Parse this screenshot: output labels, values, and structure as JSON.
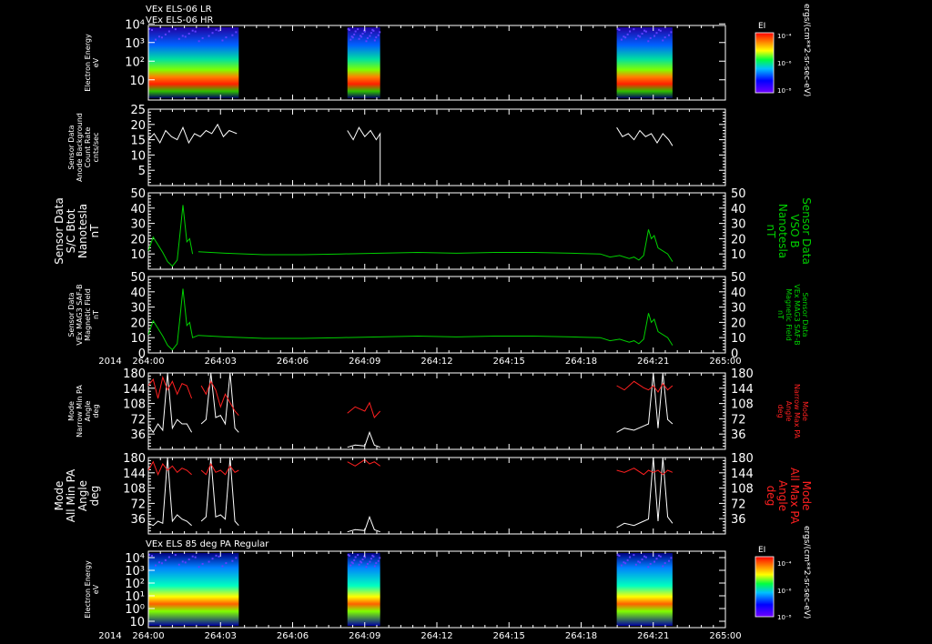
{
  "header": {
    "line1": "VEx ELS-06 LR",
    "line2": "VEx ELS-06 HR",
    "lower_title": "VEx ELS 85 deg PA Regular"
  },
  "colors": {
    "white": "#ffffff",
    "green": "#00d000",
    "red": "#ff2020",
    "frame": "#ffffff"
  },
  "time_axis": {
    "year": "2014",
    "ticks": [
      "264:00",
      "264:03",
      "264:06",
      "264:09",
      "264:12",
      "264:15",
      "264:18",
      "264:21",
      "265:00"
    ],
    "start_min": 0,
    "end_min": 60
  },
  "colorbar": {
    "label": "EI",
    "unit": "ergs/(cm**2-sr-sec-eV)",
    "top_ticks": [
      "10⁻⁴",
      "10⁻⁶",
      "10⁻⁸"
    ]
  },
  "chart_data": [
    {
      "id": "spectrogram_upper",
      "type": "heatmap",
      "ylabel": "Electron Energy",
      "yunit": "eV",
      "yticks": [
        "10",
        "10²",
        "10³",
        "10⁴"
      ],
      "data_intervals_min": [
        [
          0,
          9.4
        ],
        [
          20.7,
          24.1
        ],
        [
          48.7,
          54.5
        ]
      ]
    },
    {
      "id": "background_count",
      "type": "line",
      "ylabel": "Sensor Data",
      "ylabel2": "Anode Background",
      "ylabel3": "Count Rate",
      "yunit": "cnts/sec",
      "yticks": [
        "5",
        "10",
        "15",
        "20",
        "25"
      ],
      "ylim": [
        0,
        25
      ],
      "series": [
        {
          "segments": [
            {
              "x": [
                0,
                0.6,
                1.2,
                1.8,
                2.4,
                3,
                3.6,
                4.2,
                4.8,
                5.4,
                6,
                6.6,
                7.2,
                7.8,
                8.4,
                9.2
              ],
              "y": [
                15,
                17,
                14,
                18,
                16,
                15,
                19,
                14,
                17,
                16,
                18,
                17,
                20,
                16,
                18,
                17
              ]
            },
            {
              "x": [
                20.7,
                21.3,
                21.9,
                22.5,
                23.1,
                23.7,
                24.1,
                24.1
              ],
              "y": [
                18,
                15,
                19,
                16,
                18,
                15,
                17,
                0
              ]
            },
            {
              "x": [
                48.7,
                49.3,
                49.9,
                50.5,
                51.1,
                51.7,
                52.3,
                52.9,
                53.5,
                54.1,
                54.5
              ],
              "y": [
                19,
                16,
                17,
                15,
                18,
                16,
                17,
                14,
                17,
                15,
                13
              ]
            }
          ]
        }
      ]
    },
    {
      "id": "bmag_sc",
      "type": "line",
      "ylabel": "Sensor Data",
      "ylabel2": "S/C Btot",
      "ylabel3": "Nanotesla",
      "yunit": "nT",
      "right_label": "Sensor Data",
      "right_label2": "VSO B",
      "right_label3": "Nanotesla",
      "right_unit": "nT",
      "yticks": [
        "10",
        "20",
        "30",
        "40",
        "50"
      ],
      "ylim": [
        0,
        50
      ],
      "series": [
        {
          "segments": [
            {
              "x": [
                0,
                0.5,
                1,
                1.5,
                2,
                2.5,
                3,
                3.3,
                3.6,
                4,
                4.3,
                4.6
              ],
              "y": [
                12,
                21,
                16,
                11,
                5,
                2,
                6,
                24,
                42,
                18,
                20,
                10
              ]
            },
            {
              "x": [
                5.2,
                8,
                12,
                16,
                20,
                24,
                28,
                32,
                36,
                40,
                44,
                47,
                48,
                49,
                50,
                50.5,
                51,
                51.5,
                52,
                52.3,
                52.6,
                53,
                54,
                54.5
              ],
              "y": [
                11.5,
                10.5,
                9.5,
                9.5,
                10,
                10.5,
                11,
                10.5,
                11,
                11,
                10.5,
                10,
                8,
                9,
                7,
                8,
                6,
                9,
                26,
                20,
                22,
                14,
                10,
                5
              ]
            }
          ]
        }
      ]
    },
    {
      "id": "bmag_mag",
      "type": "line",
      "ylabel": "Sensor Data",
      "ylabel2": "VEx MAG3 SAF-B",
      "ylabel3": "Magnetic Field",
      "yunit": "nT",
      "right_label": "Sensor Data",
      "right_label2": "VEx MAG3 SAF-B",
      "right_label3": "Magnetic Field",
      "right_unit": "nT",
      "yticks": [
        "0",
        "10",
        "20",
        "30",
        "40",
        "50"
      ],
      "ylim": [
        0,
        50
      ],
      "series": [
        {
          "segments": [
            {
              "x": [
                0,
                0.5,
                1,
                1.5,
                2,
                2.5,
                3,
                3.3,
                3.6,
                4,
                4.3,
                4.6,
                5.2,
                8,
                12,
                16,
                20,
                24,
                28,
                32,
                36,
                40,
                44,
                47,
                48,
                49,
                50,
                50.5,
                51,
                51.5,
                52,
                52.3,
                52.6,
                53,
                54,
                54.5
              ],
              "y": [
                12,
                21,
                16,
                11,
                5,
                2,
                6,
                24,
                42,
                18,
                20,
                10,
                11.5,
                10.5,
                9.5,
                9.5,
                10,
                10.5,
                11,
                10.5,
                11,
                11,
                10.5,
                10,
                8,
                9,
                7,
                8,
                6,
                9,
                26,
                20,
                22,
                14,
                10,
                5
              ]
            }
          ]
        }
      ]
    },
    {
      "id": "narrow_pa",
      "type": "line",
      "ylabel": "Mode",
      "ylabel2": "Narrow Min PA",
      "ylabel3": "Angle",
      "yunit": "deg",
      "right_label": "Mode",
      "right_label2": "Narrow Max PA",
      "right_label3": "Angle",
      "right_unit": "deg",
      "yticks": [
        "36",
        "72",
        "108",
        "144",
        "180"
      ],
      "ylim": [
        0,
        180
      ],
      "series": [
        {
          "name": "min",
          "segments": [
            {
              "x": [
                0,
                0.5,
                1,
                1.5,
                2,
                2.5,
                3,
                3.5,
                4,
                4.5
              ],
              "y": [
                55,
                40,
                60,
                45,
                180,
                50,
                70,
                60,
                60,
                40
              ]
            },
            {
              "x": [
                5.5,
                6,
                6.5,
                7,
                7.5,
                8,
                8.5,
                9,
                9.4
              ],
              "y": [
                60,
                70,
                180,
                75,
                80,
                60,
                180,
                50,
                40
              ]
            },
            {
              "x": [
                20.7,
                21.5,
                22.5,
                23,
                23.5,
                24.1
              ],
              "y": [
                5,
                10,
                8,
                40,
                10,
                5
              ]
            },
            {
              "x": [
                48.7,
                49.5,
                50.5,
                51.5,
                52,
                52.5,
                53,
                53.5,
                54,
                54.5
              ],
              "y": [
                40,
                50,
                45,
                55,
                60,
                180,
                50,
                180,
                70,
                60
              ]
            }
          ]
        },
        {
          "name": "max",
          "segments": [
            {
              "x": [
                0,
                0.5,
                1,
                1.5,
                2,
                2.5,
                3,
                3.5,
                4,
                4.5
              ],
              "y": [
                150,
                165,
                120,
                170,
                140,
                160,
                130,
                155,
                150,
                120
              ]
            },
            {
              "x": [
                5.5,
                6,
                6.5,
                7,
                7.5,
                8,
                8.5,
                9,
                9.4
              ],
              "y": [
                150,
                130,
                160,
                140,
                100,
                130,
                110,
                90,
                80
              ]
            },
            {
              "x": [
                20.7,
                21.5,
                22.5,
                23,
                23.5,
                24.1
              ],
              "y": [
                85,
                100,
                90,
                110,
                75,
                90
              ]
            },
            {
              "x": [
                48.7,
                49.5,
                50.5,
                51.5,
                52,
                52.5,
                53,
                53.5,
                54,
                54.5
              ],
              "y": [
                150,
                140,
                160,
                145,
                140,
                150,
                135,
                155,
                140,
                150
              ]
            }
          ]
        }
      ]
    },
    {
      "id": "all_pa",
      "type": "line",
      "ylabel": "Mode",
      "ylabel2": "All Min PA",
      "ylabel3": "Angle",
      "yunit": "deg",
      "right_label": "Mode",
      "right_label2": "All Max PA",
      "right_label3": "Angle",
      "right_unit": "deg",
      "yticks": [
        "36",
        "72",
        "108",
        "144",
        "180"
      ],
      "ylim": [
        0,
        180
      ],
      "series": [
        {
          "name": "min",
          "segments": [
            {
              "x": [
                0,
                0.5,
                1,
                1.5,
                2,
                2.5,
                3,
                3.5,
                4,
                4.5
              ],
              "y": [
                25,
                20,
                30,
                25,
                180,
                30,
                45,
                35,
                30,
                20
              ]
            },
            {
              "x": [
                5.5,
                6,
                6.5,
                7,
                7.5,
                8,
                8.5,
                9,
                9.4
              ],
              "y": [
                30,
                40,
                180,
                40,
                45,
                35,
                180,
                30,
                20
              ]
            },
            {
              "x": [
                20.7,
                21.5,
                22.5,
                23,
                23.5,
                24.1
              ],
              "y": [
                5,
                10,
                8,
                40,
                10,
                5
              ]
            },
            {
              "x": [
                48.7,
                49.5,
                50.5,
                51.5,
                52,
                52.5,
                53,
                53.5,
                54,
                54.5
              ],
              "y": [
                15,
                25,
                20,
                30,
                35,
                180,
                30,
                180,
                40,
                25
              ]
            }
          ]
        },
        {
          "name": "max",
          "segments": [
            {
              "x": [
                0,
                0.5,
                1,
                1.5,
                2,
                2.5,
                3,
                3.5,
                4,
                4.5
              ],
              "y": [
                150,
                170,
                140,
                165,
                150,
                160,
                145,
                155,
                150,
                140
              ]
            },
            {
              "x": [
                5.5,
                6,
                6.5,
                7,
                7.5,
                8,
                8.5,
                9,
                9.4
              ],
              "y": [
                150,
                140,
                165,
                145,
                150,
                140,
                160,
                145,
                150
              ]
            },
            {
              "x": [
                20.7,
                21.5,
                22.5,
                23,
                23.5,
                24.1
              ],
              "y": [
                170,
                160,
                175,
                165,
                170,
                160
              ]
            },
            {
              "x": [
                48.7,
                49.5,
                50.5,
                51.5,
                52,
                52.5,
                53,
                53.5,
                54,
                54.5
              ],
              "y": [
                150,
                145,
                155,
                140,
                150,
                145,
                150,
                140,
                150,
                145
              ]
            }
          ]
        }
      ]
    },
    {
      "id": "spectrogram_lower",
      "type": "heatmap",
      "ylabel": "Electron Energy",
      "yunit": "eV",
      "yticks": [
        "10",
        "10⁰",
        "10¹",
        "10²",
        "10³",
        "10⁴"
      ],
      "data_intervals_min": [
        [
          0,
          9.4
        ],
        [
          20.7,
          24.1
        ],
        [
          48.7,
          54.5
        ]
      ]
    }
  ]
}
